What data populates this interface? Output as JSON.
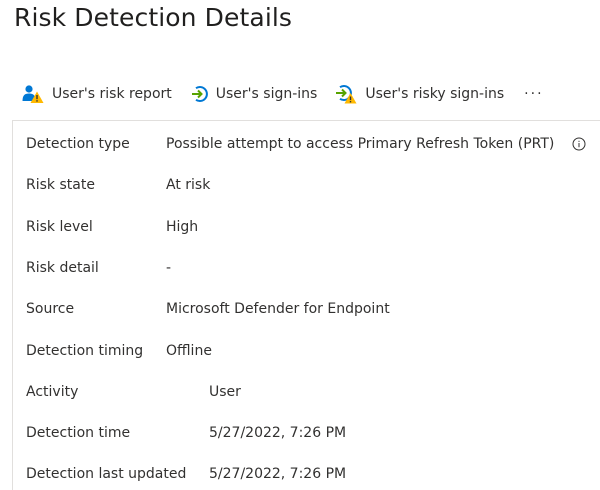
{
  "page": {
    "title": "Risk Detection Details"
  },
  "toolbar": {
    "users_risk_report": "User's risk report",
    "users_signins": "User's sign-ins",
    "users_risky_signins": "User's risky sign-ins",
    "more": "···"
  },
  "details": {
    "detection_type": {
      "label": "Detection type",
      "value": "Possible attempt to access Primary Refresh Token (PRT)"
    },
    "risk_state": {
      "label": "Risk state",
      "value": "At risk"
    },
    "risk_level": {
      "label": "Risk level",
      "value": "High"
    },
    "risk_detail": {
      "label": "Risk detail",
      "value": "-"
    },
    "source": {
      "label": "Source",
      "value": "Microsoft Defender for Endpoint"
    },
    "detection_timing": {
      "label": "Detection timing",
      "value": "Offline"
    },
    "activity": {
      "label": "Activity",
      "value": "User"
    },
    "detection_time": {
      "label": "Detection time",
      "value": "5/27/2022, 7:26 PM"
    },
    "detection_last_updated": {
      "label": "Detection last updated",
      "value": "5/27/2022, 7:26 PM"
    }
  },
  "icons": {
    "users_risk_report": "user-warning-icon",
    "users_signins": "sign-in-arrow-icon",
    "users_risky_signins": "risky-sign-in-icon",
    "info": "info-icon"
  },
  "colors": {
    "accent_blue": "#0078d4",
    "warning_yellow": "#ffb900",
    "sign_in_green": "#57a300"
  }
}
